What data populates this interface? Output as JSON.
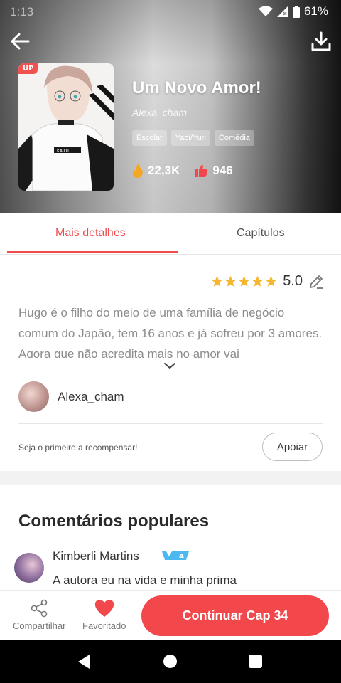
{
  "status_bar": {
    "time": "1:13",
    "battery": "61%"
  },
  "header": {
    "title": "Um Novo Amor!",
    "author": "Alexa_cham",
    "up_badge": "UP",
    "tags": [
      "Escolar",
      "Yaoi/Yuri",
      "Comédia"
    ],
    "views": "22,3K",
    "likes": "946",
    "icons": {
      "back": "back-arrow-icon",
      "download": "download-icon",
      "views": "fire-icon",
      "likes": "thumbs-up-icon"
    }
  },
  "tabs": [
    {
      "label": "Mais detalhes",
      "active": true
    },
    {
      "label": "Capítulos",
      "active": false
    }
  ],
  "details": {
    "rating_value": "5.0",
    "stars": 5,
    "synopsis": "Hugo é o filho do meio de uma família de negócio comum do Japão, tem 16 anos e já sofreu por 3 amores. Agora que não acredita mais no amor vai",
    "author_name": "Alexa_cham",
    "reward_text": "Seja o primeiro a recompensar!",
    "support_label": "Apoiar"
  },
  "comments": {
    "title": "Comentários populares",
    "items": [
      {
        "user": "Kimberli Martins",
        "level": "4",
        "text": "A autora eu na vida e minha prima"
      }
    ]
  },
  "bottom_bar": {
    "share_label": "Compartilhar",
    "favorite_label": "Favoritado",
    "continue_label": "Continuar Cap 34"
  },
  "colors": {
    "accent": "#ef4a4c",
    "star": "#f5b731",
    "fire": "#f5a623"
  }
}
